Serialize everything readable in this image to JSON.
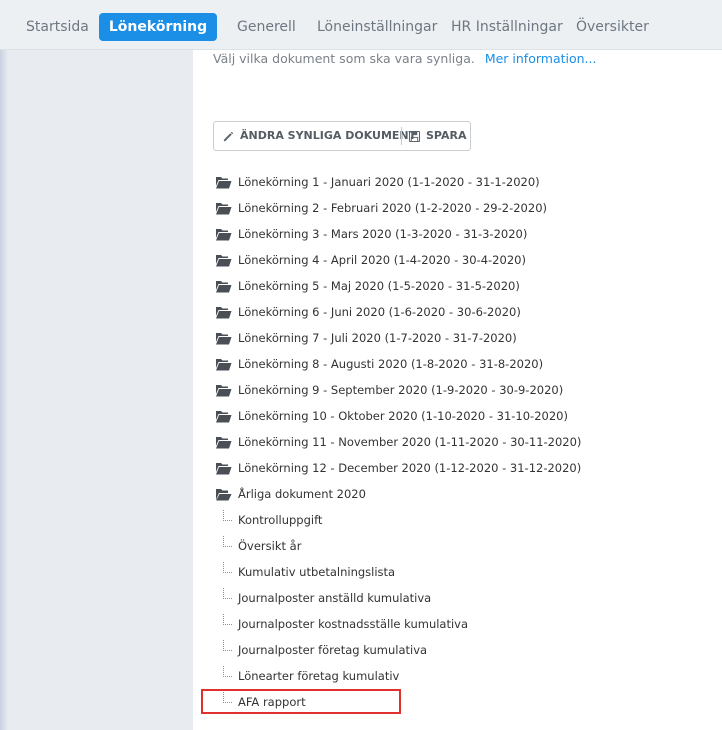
{
  "nav": {
    "tabs": [
      {
        "label": "Startsida",
        "active": false
      },
      {
        "label": "Lönekörning",
        "active": true
      },
      {
        "label": "Generell",
        "active": false
      },
      {
        "label": "Löneinställningar",
        "active": false
      },
      {
        "label": "HR Inställningar",
        "active": false
      },
      {
        "label": "Översikter",
        "active": false
      }
    ]
  },
  "content": {
    "intro_text": "Välj vilka dokument som ska vara synliga.",
    "intro_link": "Mer information...",
    "toolbar": {
      "edit_label": "ÄNDRA SYNLIGA DOKUMENT",
      "save_label": "SPARA"
    },
    "tree": {
      "folders": [
        {
          "label": "Lönekörning 1 - Januari 2020 (1-1-2020 - 31-1-2020)",
          "icon": "folder-closed-icon"
        },
        {
          "label": "Lönekörning 2 - Februari 2020 (1-2-2020 - 29-2-2020)",
          "icon": "folder-closed-icon"
        },
        {
          "label": "Lönekörning 3 - Mars 2020 (1-3-2020 - 31-3-2020)",
          "icon": "folder-closed-icon"
        },
        {
          "label": "Lönekörning 4 - April 2020 (1-4-2020 - 30-4-2020)",
          "icon": "folder-closed-icon"
        },
        {
          "label": "Lönekörning 5 - Maj 2020 (1-5-2020 - 31-5-2020)",
          "icon": "folder-closed-icon"
        },
        {
          "label": "Lönekörning 6 - Juni 2020 (1-6-2020 - 30-6-2020)",
          "icon": "folder-closed-icon"
        },
        {
          "label": "Lönekörning 7 - Juli 2020 (1-7-2020 - 31-7-2020)",
          "icon": "folder-closed-icon"
        },
        {
          "label": "Lönekörning 8 - Augusti 2020 (1-8-2020 - 31-8-2020)",
          "icon": "folder-closed-icon"
        },
        {
          "label": "Lönekörning 9 - September 2020 (1-9-2020 - 30-9-2020)",
          "icon": "folder-closed-icon"
        },
        {
          "label": "Lönekörning 10 - Oktober 2020 (1-10-2020 - 31-10-2020)",
          "icon": "folder-closed-icon"
        },
        {
          "label": "Lönekörning 11 - November 2020 (1-11-2020 - 30-11-2020)",
          "icon": "folder-closed-icon"
        },
        {
          "label": "Lönekörning 12 - December 2020 (1-12-2020 - 31-12-2020)",
          "icon": "folder-closed-icon"
        },
        {
          "label": "Årliga dokument 2020",
          "icon": "folder-open-icon"
        }
      ],
      "annual_documents": [
        {
          "label": "Kontrolluppgift"
        },
        {
          "label": "Översikt år"
        },
        {
          "label": "Kumulativ utbetalningslista"
        },
        {
          "label": "Journalposter anställd kumulativa"
        },
        {
          "label": "Journalposter kostnadsställe kumulativa"
        },
        {
          "label": "Journalposter företag kumulativa"
        },
        {
          "label": "Lönearter företag kumulativ"
        },
        {
          "label": "AFA rapport"
        }
      ]
    },
    "highlight_color": "#e0312c",
    "accent_color": "#1b8ee6"
  }
}
